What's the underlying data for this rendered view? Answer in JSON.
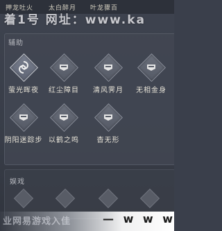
{
  "top_tabs": [
    "押龙吐火",
    "太白醉月",
    "叶龙骤百"
  ],
  "watermark": {
    "top": "着1号   网址：www.ka",
    "bottom_left": "业网易游戏入佳",
    "bottom_right": "— w w w"
  },
  "sections": [
    {
      "label": "辅助",
      "skills": [
        {
          "name": "萤光晖夜",
          "icon": "swirl-icon",
          "active": true
        },
        {
          "name": "红尘障目",
          "icon": "helmet-icon",
          "active": false
        },
        {
          "name": "清风霁月",
          "icon": "helmet-icon",
          "active": false
        },
        {
          "name": "无相金身",
          "icon": "helmet-icon",
          "active": false
        },
        {
          "name": "阴阳迷踪步",
          "icon": "helmet-icon",
          "active": false
        },
        {
          "name": "以鹤之鸣",
          "icon": "helmet-icon",
          "active": false
        },
        {
          "name": "杳无形",
          "icon": "helmet-icon",
          "active": false
        }
      ]
    },
    {
      "label": "娱戏"
    }
  ]
}
